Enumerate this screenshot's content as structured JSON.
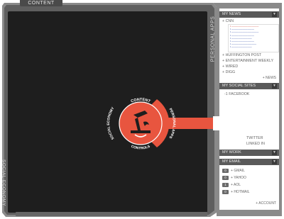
{
  "tabs": {
    "content": "CONTENT",
    "personal_apps": "PERSONAL APPS",
    "social_economy": "SOCIAL ECONOMY"
  },
  "wheel": {
    "content": "CONTENT",
    "personal_apps": "PERSONAL APPS",
    "social_economy": "SOCIAL ECONOMY",
    "controls": "CONTROLS"
  },
  "colors": {
    "accent": "#e8553f",
    "panel_header": "#5a5a5a",
    "frame": "#7a7a7a",
    "main_bg": "#1e1e1e"
  },
  "my_news": {
    "title": "MY NEWS",
    "sources": [
      "CNN",
      "HUFFINGTON POST",
      "ENTERTAINMENT WEEKLY",
      "WIRED",
      "DIGG"
    ],
    "add": "+ NEWS"
  },
  "my_social": {
    "title": "MY SOCIAL SITES",
    "sites": [
      "FACEBOOK",
      "TWITTER",
      "LINKED IN"
    ],
    "facebook_badge": "-1"
  },
  "my_work": {
    "title": "MY WORK"
  },
  "my_email": {
    "title": "MY EMAIL",
    "accounts": [
      {
        "badge": "0",
        "label": "GMAIL"
      },
      {
        "badge": "0",
        "label": "YAHOO"
      },
      {
        "badge": "1",
        "label": "AOL"
      },
      {
        "badge": "0",
        "label": "HOTMAIL"
      }
    ],
    "add": "+ ACCOUNT"
  },
  "icons": {
    "hand": "pointing-hand-icon",
    "chevron": "chevron-down-icon"
  }
}
